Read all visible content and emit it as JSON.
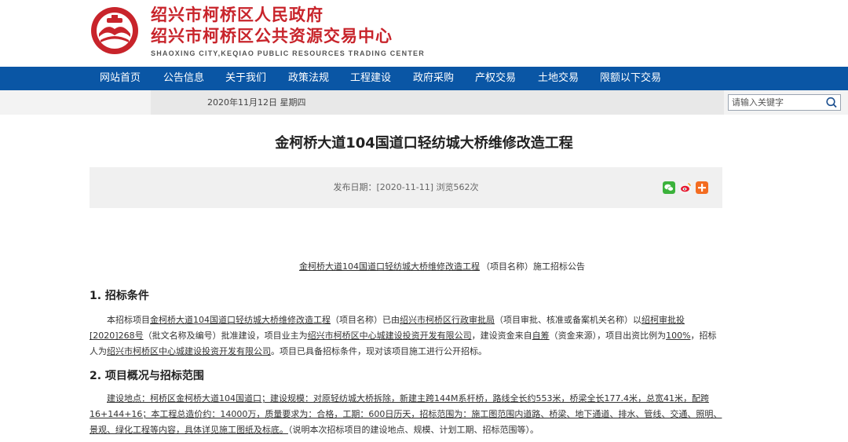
{
  "header": {
    "title1": "绍兴市柯桥区人民政府",
    "title2": "绍兴市柯桥区公共资源交易中心",
    "subtitle": "SHAOXING CITY,KEQIAO PUBLIC RESOURCES TRADING CENTER",
    "brand_color": "#c8242b"
  },
  "nav": {
    "color": "#0a56a5",
    "items": [
      "网站首页",
      "公告信息",
      "关于我们",
      "政策法规",
      "工程建设",
      "政府采购",
      "产权交易",
      "土地交易",
      "限额以下交易"
    ]
  },
  "datebar": {
    "date": "2020年11月12日 星期四"
  },
  "search": {
    "placeholder": "请输入关键字",
    "icon": "search-icon"
  },
  "article": {
    "title": "金柯桥大道104国道口轻纺城大桥维修改造工程",
    "meta": "发布日期：[2020-11-11] 浏览562次",
    "share_icons": [
      "wechat-icon",
      "weibo-icon",
      "more-share-icon"
    ],
    "notice": {
      "project_name": "金柯桥大道104国道口轻纺城大桥维修改造工程",
      "suffix": "（项目名称）施工招标公告"
    },
    "section1": {
      "heading": "1. 招标条件",
      "p1a": "本招标项目",
      "p1b": "金柯桥大道104国道口轻纺城大桥维修改造工程",
      "p1c": "（项目名称）已由",
      "p1d": "绍兴市柯桥区行政审批局",
      "p1e": "（项目审批、核准或备案机关名称）以",
      "p1f": "绍柯审批投[2020]268号",
      "p1g": "（批文名称及编号）批准建设，项目业主为",
      "p1h": "绍兴市柯桥区中心城建设投资开发有限公司",
      "p1i": "，建设资金来自",
      "p1j": "自筹",
      "p1k": "（资金来源），项目出资比例为",
      "p1l": "100%",
      "p1m": "，招标人为",
      "p1n": "绍兴市柯桥区中心城建设投资开发有限公司",
      "p1o": "。项目已具备招标条件，现对该项目施工进行公开招标。"
    },
    "section2": {
      "heading": "2. 项目概况与招标范围",
      "p2a": "建设地点：柯桥区金柯桥大道104国道口；建设规模：对原轻纺城大桥拆除，新建主跨144M系杆桥，路线全长约553米，桥梁全长177.4米，总宽41米，配跨16+144+16；本工程总造价约：14000万，质量要求为：合格，工期：600日历天，招标范围为：施工图范围内道路、桥梁、地下通道、排水、管线、交通、照明、景观、绿化工程等内容，具体详见施工图纸及标底。",
      "p2b": "（说明本次招标项目的建设地点、规模、计划工期、招标范围等）。"
    }
  }
}
